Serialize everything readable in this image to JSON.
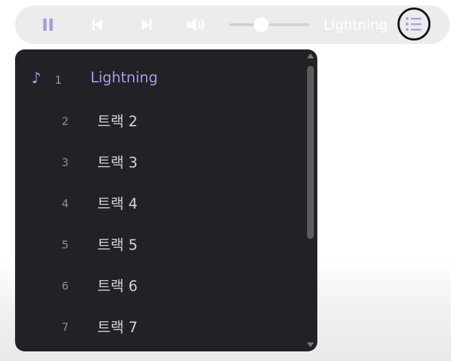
{
  "player": {
    "now_playing_title": "Lightning",
    "volume_level": 0.4,
    "icons": {
      "pause": "pause-icon",
      "previous": "skip-previous-icon",
      "next": "skip-next-icon",
      "volume": "volume-icon",
      "playlist": "playlist-icon"
    },
    "colors": {
      "accent": "#a89ae8",
      "bar": "#ececec",
      "panel": "#222126"
    }
  },
  "playlist": {
    "now_playing_marker": "♪",
    "tracks": [
      {
        "number": "1",
        "title": "Lightning"
      },
      {
        "number": "2",
        "title": "트랙 2"
      },
      {
        "number": "3",
        "title": "트랙 3"
      },
      {
        "number": "4",
        "title": "트랙 4"
      },
      {
        "number": "5",
        "title": "트랙 5"
      },
      {
        "number": "6",
        "title": "트랙 6"
      },
      {
        "number": "7",
        "title": "트랙 7"
      }
    ]
  }
}
